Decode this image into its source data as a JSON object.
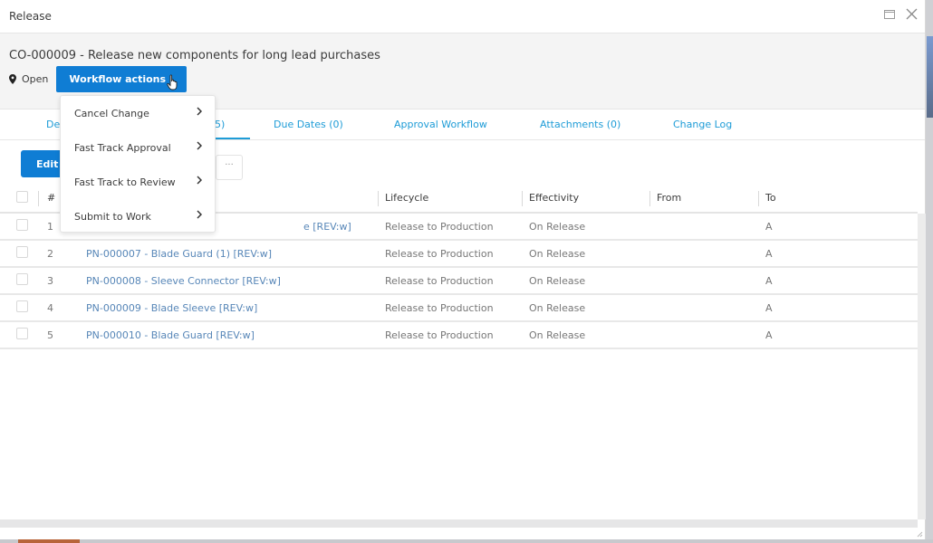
{
  "window": {
    "title": "Release",
    "icons": [
      "maximize-icon",
      "close-icon"
    ]
  },
  "header": {
    "change_order_title": "CO-000009 - Release new components for long lead purchases",
    "status_label": "Open",
    "status_icon": "location-pin-icon",
    "workflow_button_label": "Workflow actions"
  },
  "workflow_menu": {
    "items": [
      {
        "label": "Cancel Change"
      },
      {
        "label": "Fast Track Approval"
      },
      {
        "label": "Fast Track to Review"
      },
      {
        "label": "Submit to Work"
      }
    ]
  },
  "tabs": [
    {
      "label": "De",
      "active": false
    },
    {
      "label": "5)",
      "active": true
    },
    {
      "label": "Due Dates (0)",
      "active": false
    },
    {
      "label": "Approval Workflow",
      "active": false
    },
    {
      "label": "Attachments (0)",
      "active": false
    },
    {
      "label": "Change Log",
      "active": false
    }
  ],
  "toolbar": {
    "edit_label": "Edit",
    "more_label": "···"
  },
  "table": {
    "columns": [
      "#",
      "",
      "Lifecycle",
      "Effectivity",
      "From",
      "To"
    ],
    "rows": [
      {
        "num": "1",
        "item": "e [REV:w]",
        "lifecycle": "Release to Production",
        "effectivity": "On Release",
        "from": "",
        "to": "A"
      },
      {
        "num": "2",
        "item": "PN-000007 - Blade Guard (1) [REV:w]",
        "lifecycle": "Release to Production",
        "effectivity": "On Release",
        "from": "",
        "to": "A"
      },
      {
        "num": "3",
        "item": "PN-000008 - Sleeve Connector [REV:w]",
        "lifecycle": "Release to Production",
        "effectivity": "On Release",
        "from": "",
        "to": "A"
      },
      {
        "num": "4",
        "item": "PN-000009 - Blade Sleeve [REV:w]",
        "lifecycle": "Release to Production",
        "effectivity": "On Release",
        "from": "",
        "to": "A"
      },
      {
        "num": "5",
        "item": "PN-000010 - Blade Guard [REV:w]",
        "lifecycle": "Release to Production",
        "effectivity": "On Release",
        "from": "",
        "to": "A"
      }
    ]
  },
  "colors": {
    "primary": "#0f7dd4",
    "tab_link": "#1e9cd7",
    "item_link": "#5887b8"
  }
}
